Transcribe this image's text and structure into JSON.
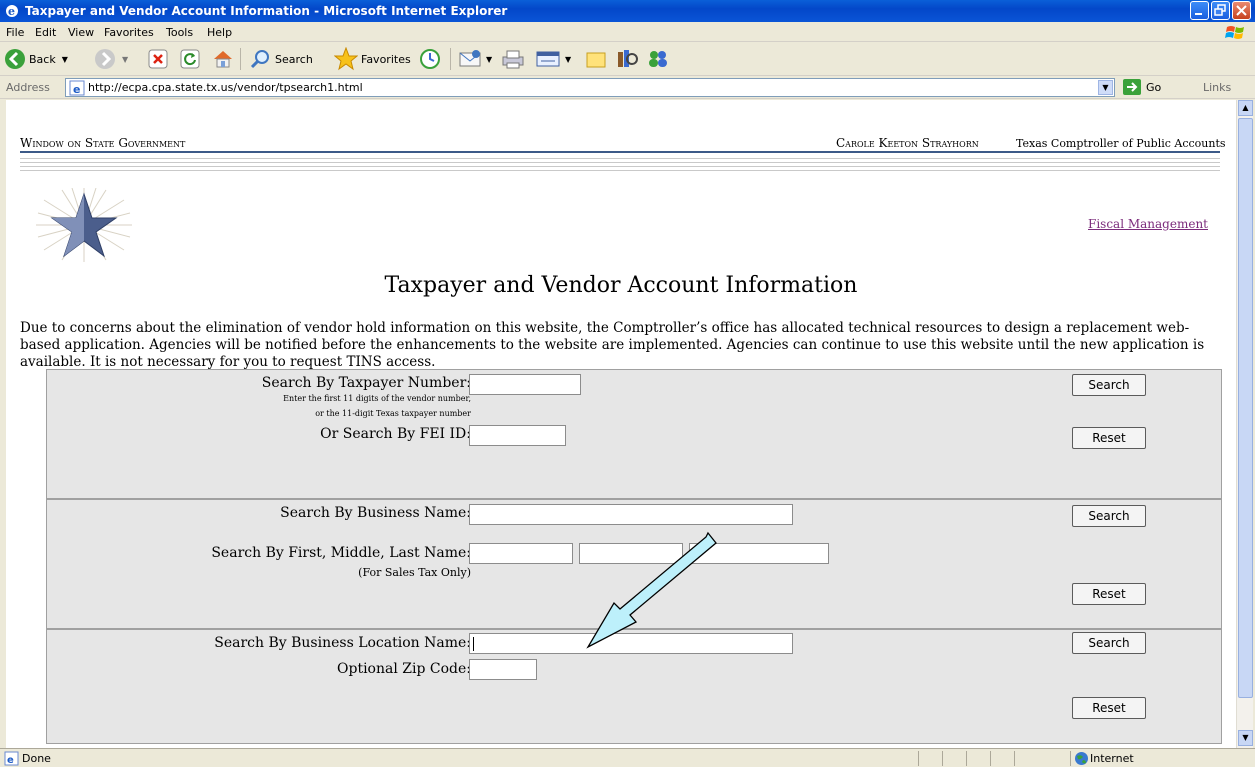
{
  "window": {
    "title": "Taxpayer and Vendor Account Information - Microsoft Internet Explorer"
  },
  "menu": [
    "File",
    "Edit",
    "View",
    "Favorites",
    "Tools",
    "Help"
  ],
  "toolbar": {
    "back": "Back",
    "search": "Search",
    "favorites": "Favorites"
  },
  "address": {
    "label": "Address",
    "url": "http://ecpa.cpa.state.tx.us/vendor/tpsearch1.html",
    "go": "Go",
    "links": "Links"
  },
  "page": {
    "site_name": "Window on State Government",
    "official": "Carole Keeton Strayhorn",
    "agency": "Texas Comptroller of Public Accounts",
    "fiscal_link": "Fiscal Management",
    "title": "Taxpayer and Vendor Account Information",
    "notice": "Due to concerns about the elimination of vendor hold information on this website, the Comptroller’s office has allocated technical resources to design a replacement web-based application. Agencies will be notified before the enhancements to the website are implemented. Agencies can continue to use this website until the new application is available. It is not necessary for you to request TINS access."
  },
  "form": {
    "taxpayer_label": "Search By Taxpayer Number:",
    "taxpayer_hint1": "Enter the first 11 digits of the vendor number,",
    "taxpayer_hint2": "or the 11-digit Texas taxpayer number",
    "fei_label": "Or Search By FEI ID:",
    "business_label": "Search By Business Name:",
    "person_label": "Search By First, Middle, Last Name:",
    "person_hint": "(For Sales Tax Only)",
    "location_label": "Search By Business Location Name:",
    "zip_label": "Optional Zip Code:",
    "search_btn": "Search",
    "reset_btn": "Reset"
  },
  "status": {
    "text": "Done",
    "zone": "Internet"
  },
  "colors": {
    "titlebar": "#0347c9",
    "arrow": "#bdf0fb",
    "link_visited": "#7b2b7b"
  }
}
